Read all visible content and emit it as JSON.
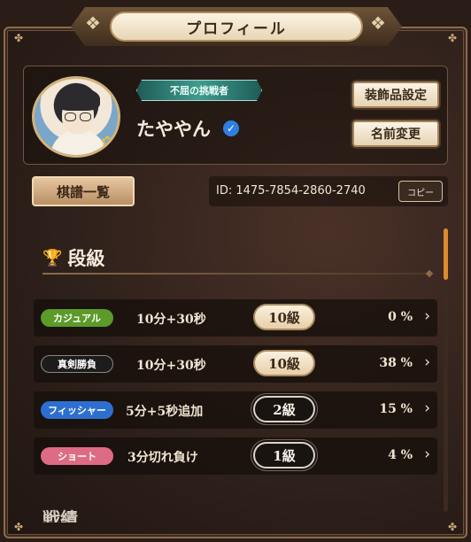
{
  "header": {
    "title": "プロフィール"
  },
  "profile": {
    "player_title": "不屈の挑戦者",
    "username": "たややん",
    "verified_icon": "check-badge-icon",
    "decoration_button": "装飾品設定",
    "rename_button": "名前変更",
    "kifu_button": "棋譜一覧",
    "id_text": "ID: 1475-7854-2860-2740",
    "copy_button": "コピー"
  },
  "ranks": {
    "section_title": "段級",
    "section_icon": "trophy-icon",
    "rows": [
      {
        "mode": "カジュアル",
        "mode_color": "#5c9a2a",
        "time": "10分+30秒",
        "rank": "10級",
        "percent": "0 %"
      },
      {
        "mode": "真剣勝負",
        "mode_color": "#1c1c1c",
        "time": "10分+30秒",
        "rank": "10級",
        "percent": "38 %"
      },
      {
        "mode": "フィッシャー",
        "mode_color": "#2d6fd0",
        "time": "5分+5秒追加",
        "rank": "2級",
        "percent": "15 %"
      },
      {
        "mode": "ショート",
        "mode_color": "#de6b86",
        "time": "3分切れ負け",
        "rank": "1級",
        "percent": "4 %"
      }
    ]
  },
  "next_section": {
    "title": "戦績"
  },
  "colors": {
    "accent": "#e08a30",
    "frame": "#8b6b4a"
  }
}
